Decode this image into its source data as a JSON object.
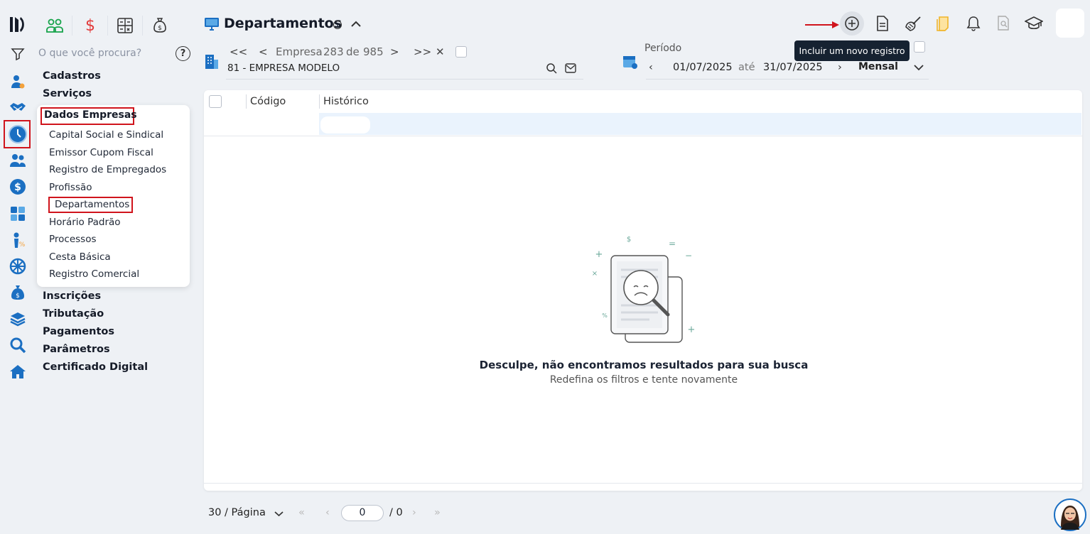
{
  "title": "Departamentos",
  "info_icon": "i",
  "search": {
    "placeholder": "O que você procura?",
    "help": "?"
  },
  "menu": {
    "top": [
      "Cadastros",
      "Serviços"
    ],
    "open_section": "Dados Empresas",
    "sub_items": [
      "Capital Social e Sindical",
      "Emissor Cupom Fiscal",
      "Registro de Empregados",
      "Profissão",
      "Departamentos",
      "Horário Padrão",
      "Processos",
      "Cesta Básica",
      "Registro Comercial"
    ],
    "bottom": [
      "Inscrições",
      "Tributação",
      "Pagamentos",
      "Parâmetros",
      "Certificado Digital"
    ]
  },
  "company_nav": {
    "first": "<<",
    "prev": "<",
    "label": "Empresa",
    "current": "283",
    "of": "de",
    "total": "985",
    "next": ">",
    "last": ">>",
    "close": "✕",
    "company": "81 - EMPRESA MODELO"
  },
  "period": {
    "label": "Período",
    "start": "01/07/2025",
    "until": "até",
    "end": "31/07/2025",
    "mode": "Mensal"
  },
  "tooltip": "Incluir um novo registro",
  "table": {
    "columns": [
      "Código",
      "Histórico"
    ]
  },
  "empty": {
    "title": "Desculpe, não encontramos resultados para sua busca",
    "subtitle": "Redefina os filtros e tente novamente"
  },
  "pagination": {
    "per_page": "30 / Página",
    "page": "0",
    "total": "/ 0"
  },
  "colors": {
    "accent": "#1b6fc2",
    "highlight": "#d0141c",
    "tooltip_bg": "#162231"
  }
}
